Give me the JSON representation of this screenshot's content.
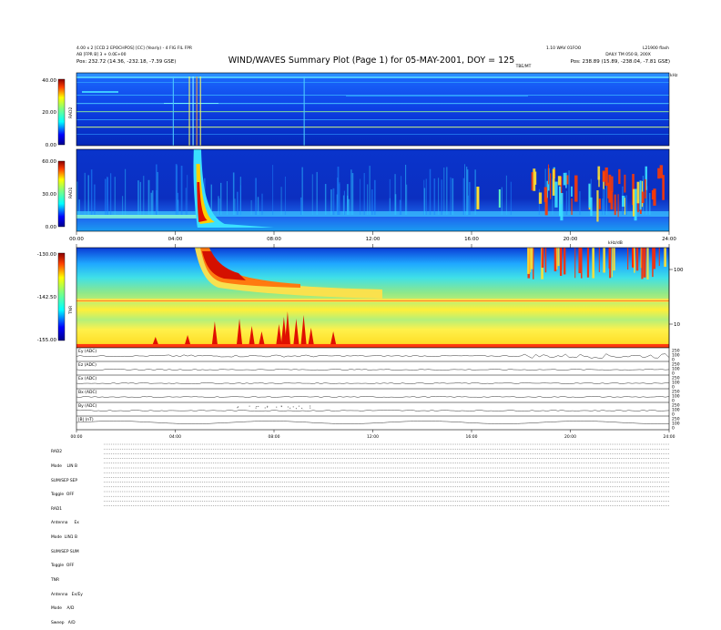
{
  "header": {
    "title": "WIND/WAVES Summary Plot (Page 1) for 05-MAY-2001, DOY = 125",
    "left_line1": "4.00 x 2 [CCD 2 EPOCHPOS] [CC] (Yearly) - 4 FIG FIL FPR",
    "left_line2": "AB [FPR B] 3 + 0.0E+00",
    "left_pos": "Pos:   232.72 (14.36, -232.18, -7.39 GSE)",
    "right_line1": "1.10 WAV 01FOO",
    "right_line2": "L21900 flash",
    "right_line3": "DAILY TM 050 B, 200X",
    "right_pos": "Pos:   238.89 (15.89, -238.04, -7.81 GSE)",
    "mid_label": "TBE/MT",
    "corner_label": "kHz"
  },
  "colorbars": [
    {
      "name": "RAD2",
      "max": "40.00",
      "mid": "20.00",
      "min": "0.00"
    },
    {
      "name": "RAD1",
      "max": "60.00",
      "mid": "30.00",
      "min": "0.00"
    },
    {
      "name": "TNR",
      "max": "-130.00",
      "mid": "-142.50",
      "min": "-155.00"
    }
  ],
  "time_ticks": [
    "00:00",
    "04:00",
    "08:00",
    "12:00",
    "16:00",
    "20:00",
    "24:00"
  ],
  "tnr_right_ticks": [
    "100",
    "10"
  ],
  "tnr_right_label": "kHz/dB",
  "line_panels": [
    "Ey (ADC)",
    "Ez (ADC)",
    "Ex (ADC)",
    "Bx (ADC)",
    "By (ADC)",
    "|B| (nT)"
  ],
  "line_right_ticks": [
    "250",
    "100",
    "0"
  ],
  "mode_lines": [
    "RAD2",
    "Mode    LIN B",
    "SUM/SEP SEP",
    "Toggle  OFF",
    "RAD1",
    "Antenna     Ex",
    "Mode  LIN1 B",
    "SUM/SEP SUM",
    "Toggle  OFF",
    "TNR",
    "Antenna   Ex/Ey",
    "Mode    A/D",
    "Sweep   A/D"
  ],
  "colors": {
    "background_blue": "#0a3ad6",
    "spectrum_dark": "#001a9e",
    "burst_red": "#d40000",
    "green_band": "#7de07a",
    "yellow_band": "#f3f25a",
    "axis": "#000000"
  },
  "chart_data": {
    "type": "heatmap",
    "title": "WIND/WAVES Summary Plot (Page 1) for 05-MAY-2001, DOY = 125",
    "x_range_hours": [
      0,
      24
    ],
    "panels": [
      {
        "name": "RAD2",
        "colorbar_range": [
          0,
          40
        ],
        "events": [
          {
            "time_h": 4.5,
            "kind": "type III burst"
          },
          {
            "time_h": 4.8,
            "kind": "type III burst"
          }
        ]
      },
      {
        "name": "RAD1",
        "colorbar_range": [
          0,
          60
        ],
        "events": [
          {
            "time_h": 4.9,
            "kind": "intense type III"
          },
          {
            "time_h": 18.6,
            "kind": "burst group"
          },
          {
            "time_h": 20.0,
            "kind": "burst group"
          },
          {
            "time_h": 23.5,
            "kind": "burst group"
          }
        ]
      },
      {
        "name": "TNR",
        "colorbar_range": [
          -155,
          -130
        ],
        "events": [
          {
            "time_h": 5.0,
            "kind": "intense burst"
          }
        ]
      }
    ],
    "line_panels": [
      "Ey (ADC)",
      "Ez (ADC)",
      "Ex (ADC)",
      "Bx (ADC)",
      "By (ADC)",
      "|B| (nT)"
    ]
  }
}
